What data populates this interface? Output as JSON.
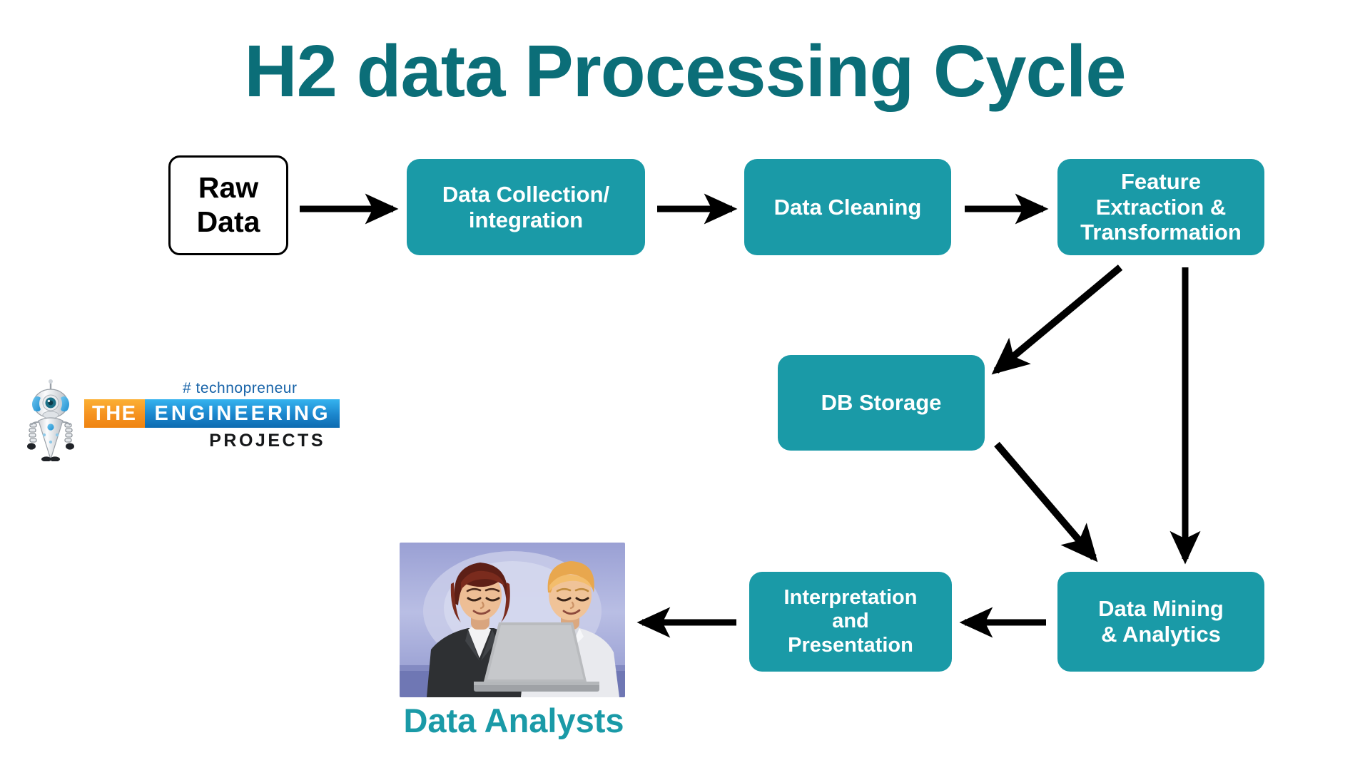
{
  "page": {
    "title": "H2 data Processing Cycle",
    "background_color": "#ffffff"
  },
  "colors": {
    "title_teal": "#0b6e78",
    "box_teal": "#1a9aa7",
    "box_text": "#ffffff",
    "arrow": "#000000",
    "raw_box_bg": "#ffffff",
    "raw_box_border": "#000000",
    "logo_orange": "#f59220",
    "logo_blue": "#1b86cd",
    "logo_tagline_blue": "#1763a8",
    "logo_projects_black": "#16181a"
  },
  "diagram": {
    "type": "flowchart",
    "nodes": [
      {
        "id": "raw-data",
        "label": "Raw\nData",
        "style": "outline"
      },
      {
        "id": "collection",
        "label": "Data Collection/\nintegration",
        "style": "filled"
      },
      {
        "id": "cleaning",
        "label": "Data Cleaning",
        "style": "filled"
      },
      {
        "id": "feature",
        "label": "Feature\nExtraction &\nTransformation",
        "style": "filled"
      },
      {
        "id": "db-storage",
        "label": "DB Storage",
        "style": "filled"
      },
      {
        "id": "interpretation",
        "label": "Interpretation\nand\nPresentation",
        "style": "filled"
      },
      {
        "id": "mining",
        "label": "Data Mining\n& Analytics",
        "style": "filled"
      }
    ],
    "edges": [
      {
        "from": "raw-data",
        "to": "collection",
        "direction": "right"
      },
      {
        "from": "collection",
        "to": "cleaning",
        "direction": "right"
      },
      {
        "from": "cleaning",
        "to": "feature",
        "direction": "right"
      },
      {
        "from": "feature",
        "to": "db-storage",
        "direction": "down-left"
      },
      {
        "from": "feature",
        "to": "mining",
        "direction": "down"
      },
      {
        "from": "db-storage",
        "to": "mining",
        "direction": "down-right"
      },
      {
        "from": "mining",
        "to": "interpretation",
        "direction": "left"
      },
      {
        "from": "interpretation",
        "to": "data-analysts",
        "direction": "left"
      }
    ]
  },
  "analysts": {
    "caption": "Data Analysts",
    "image_alt": "two-people-at-laptop-illustration"
  },
  "logo": {
    "tagline": "# technopreneur",
    "word_the": "THE",
    "word_engineering": "ENGINEERING",
    "word_projects": "PROJECTS",
    "robot_icon": "robot-mascot-icon"
  }
}
